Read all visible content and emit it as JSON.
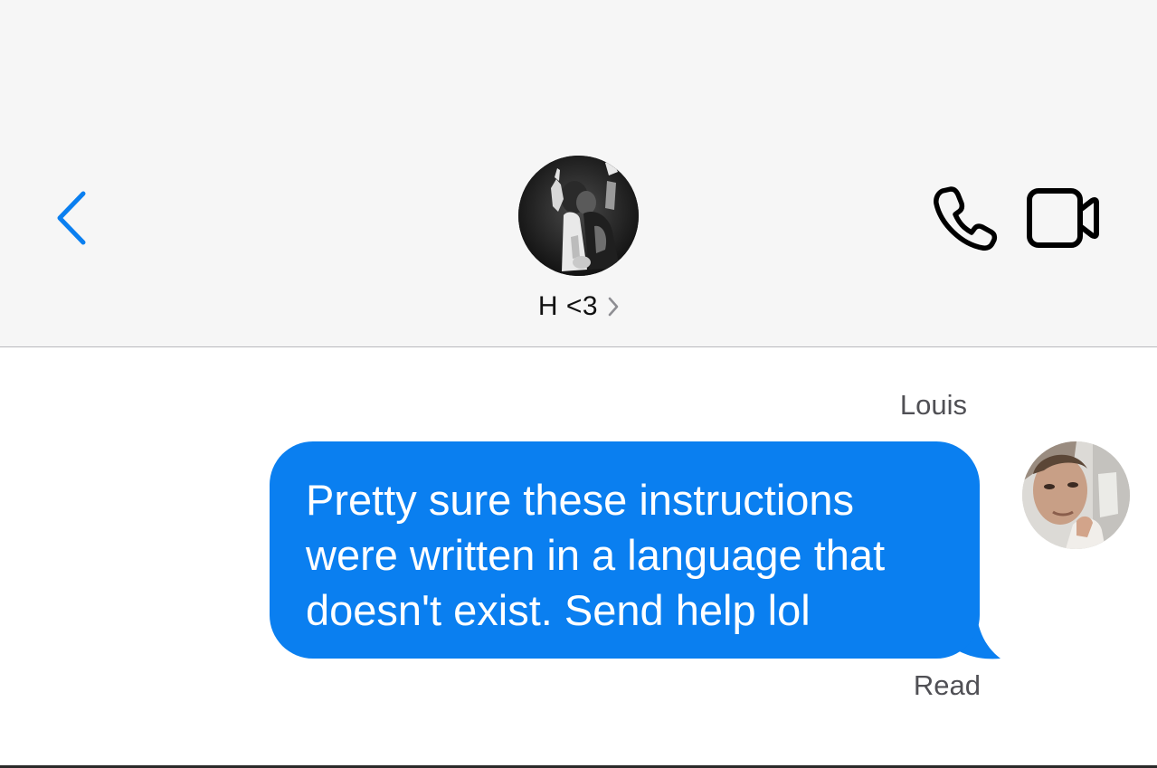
{
  "header": {
    "contact_name": "H <3",
    "back_icon": "chevron-left-icon",
    "info_icon": "chevron-right-icon",
    "call_icon": "phone-icon",
    "video_icon": "video-camera-icon"
  },
  "conversation": {
    "messages": [
      {
        "sender": "Louis",
        "text": "Pretty sure these instructions\nwere written in a language that\ndoesn't exist. Send help lol",
        "status": "Read",
        "bubble_color": "#0a7ff0",
        "outgoing": true
      }
    ]
  },
  "colors": {
    "accent": "#0a7ff0",
    "header_bg": "#f6f6f6",
    "secondary_text": "#505055"
  }
}
